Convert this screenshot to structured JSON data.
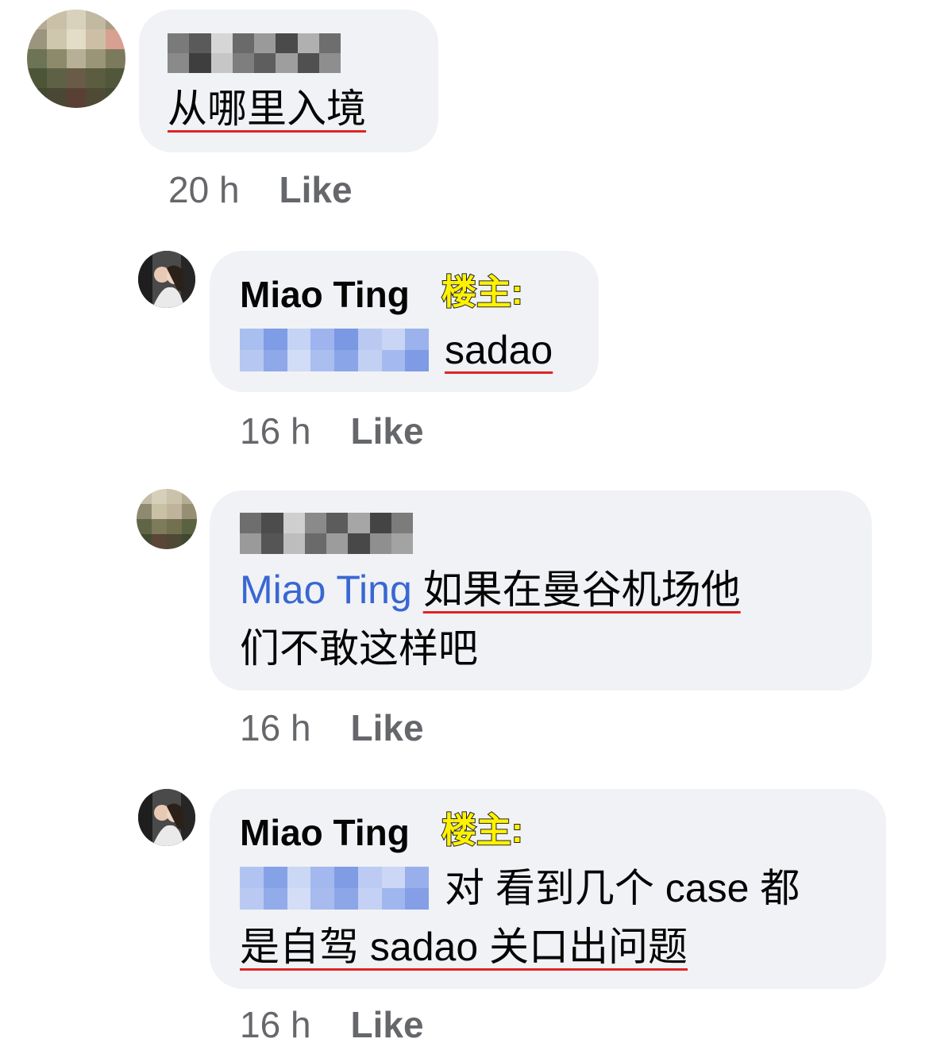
{
  "comments": [
    {
      "author_redacted": true,
      "text": "从哪里入境",
      "time": "20 h",
      "like_label": "Like"
    },
    {
      "author": "Miao Ting",
      "author_tag": "楼主:",
      "mention_redacted": true,
      "text": "sadao",
      "time": "16 h",
      "like_label": "Like"
    },
    {
      "author_redacted": true,
      "mention": "Miao Ting",
      "text_line1": "如果在曼谷机场他",
      "text_line2": "们不敢这样吧",
      "time": "16 h",
      "like_label": "Like"
    },
    {
      "author": "Miao Ting",
      "author_tag": "楼主:",
      "mention_redacted": true,
      "text_line1": "对 看到几个 case 都",
      "text_line2": "是自驾 sadao 关口出问题",
      "time": "16 h",
      "like_label": "Like"
    }
  ],
  "colors": {
    "bubble": "#f0f2f5",
    "meta": "#65676b",
    "mention": "#3967d3",
    "underline": "#e02424",
    "tag": "#fff200"
  }
}
